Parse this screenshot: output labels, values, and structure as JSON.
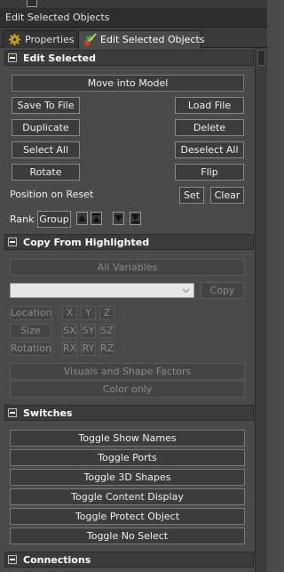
{
  "window": {
    "title": "Edit Selected Objects"
  },
  "tabs": [
    {
      "label": "Properties",
      "icon": "gear-icon"
    },
    {
      "label": "Edit Selected Objects",
      "icon": "brush-icon"
    }
  ],
  "edit_selected": {
    "title": "Edit Selected",
    "move_into_model": "Move into Model",
    "save_to_file": "Save To File",
    "load_file": "Load File",
    "duplicate": "Duplicate",
    "delete": "Delete",
    "select_all": "Select All",
    "deselect_all": "Deselect All",
    "rotate": "Rotate",
    "flip": "Flip",
    "position_on_reset": "Position on Reset",
    "set": "Set",
    "clear": "Clear",
    "rank": "Rank",
    "group": "Group"
  },
  "copy_from_highlighted": {
    "title": "Copy From Highlighted",
    "all_variables": "All Variables",
    "combo_value": "",
    "copy": "Copy",
    "location": "Location",
    "x": "X",
    "y": "Y",
    "z": "Z",
    "size": "Size",
    "sx": "SX",
    "sy": "SY",
    "sz": "SZ",
    "rotation": "Rotation",
    "rx": "RX",
    "ry": "RY",
    "rz": "RZ",
    "visuals_shape": "Visuals and Shape Factors",
    "color_only": "Color only"
  },
  "switches": {
    "title": "Switches",
    "toggle_show_names": "Toggle Show Names",
    "toggle_ports": "Toggle Ports",
    "toggle_3d_shapes": "Toggle 3D Shapes",
    "toggle_content_display": "Toggle Content Display",
    "toggle_protect_object": "Toggle Protect Object",
    "toggle_no_select": "Toggle No Select"
  },
  "connections": {
    "title": "Connections"
  }
}
